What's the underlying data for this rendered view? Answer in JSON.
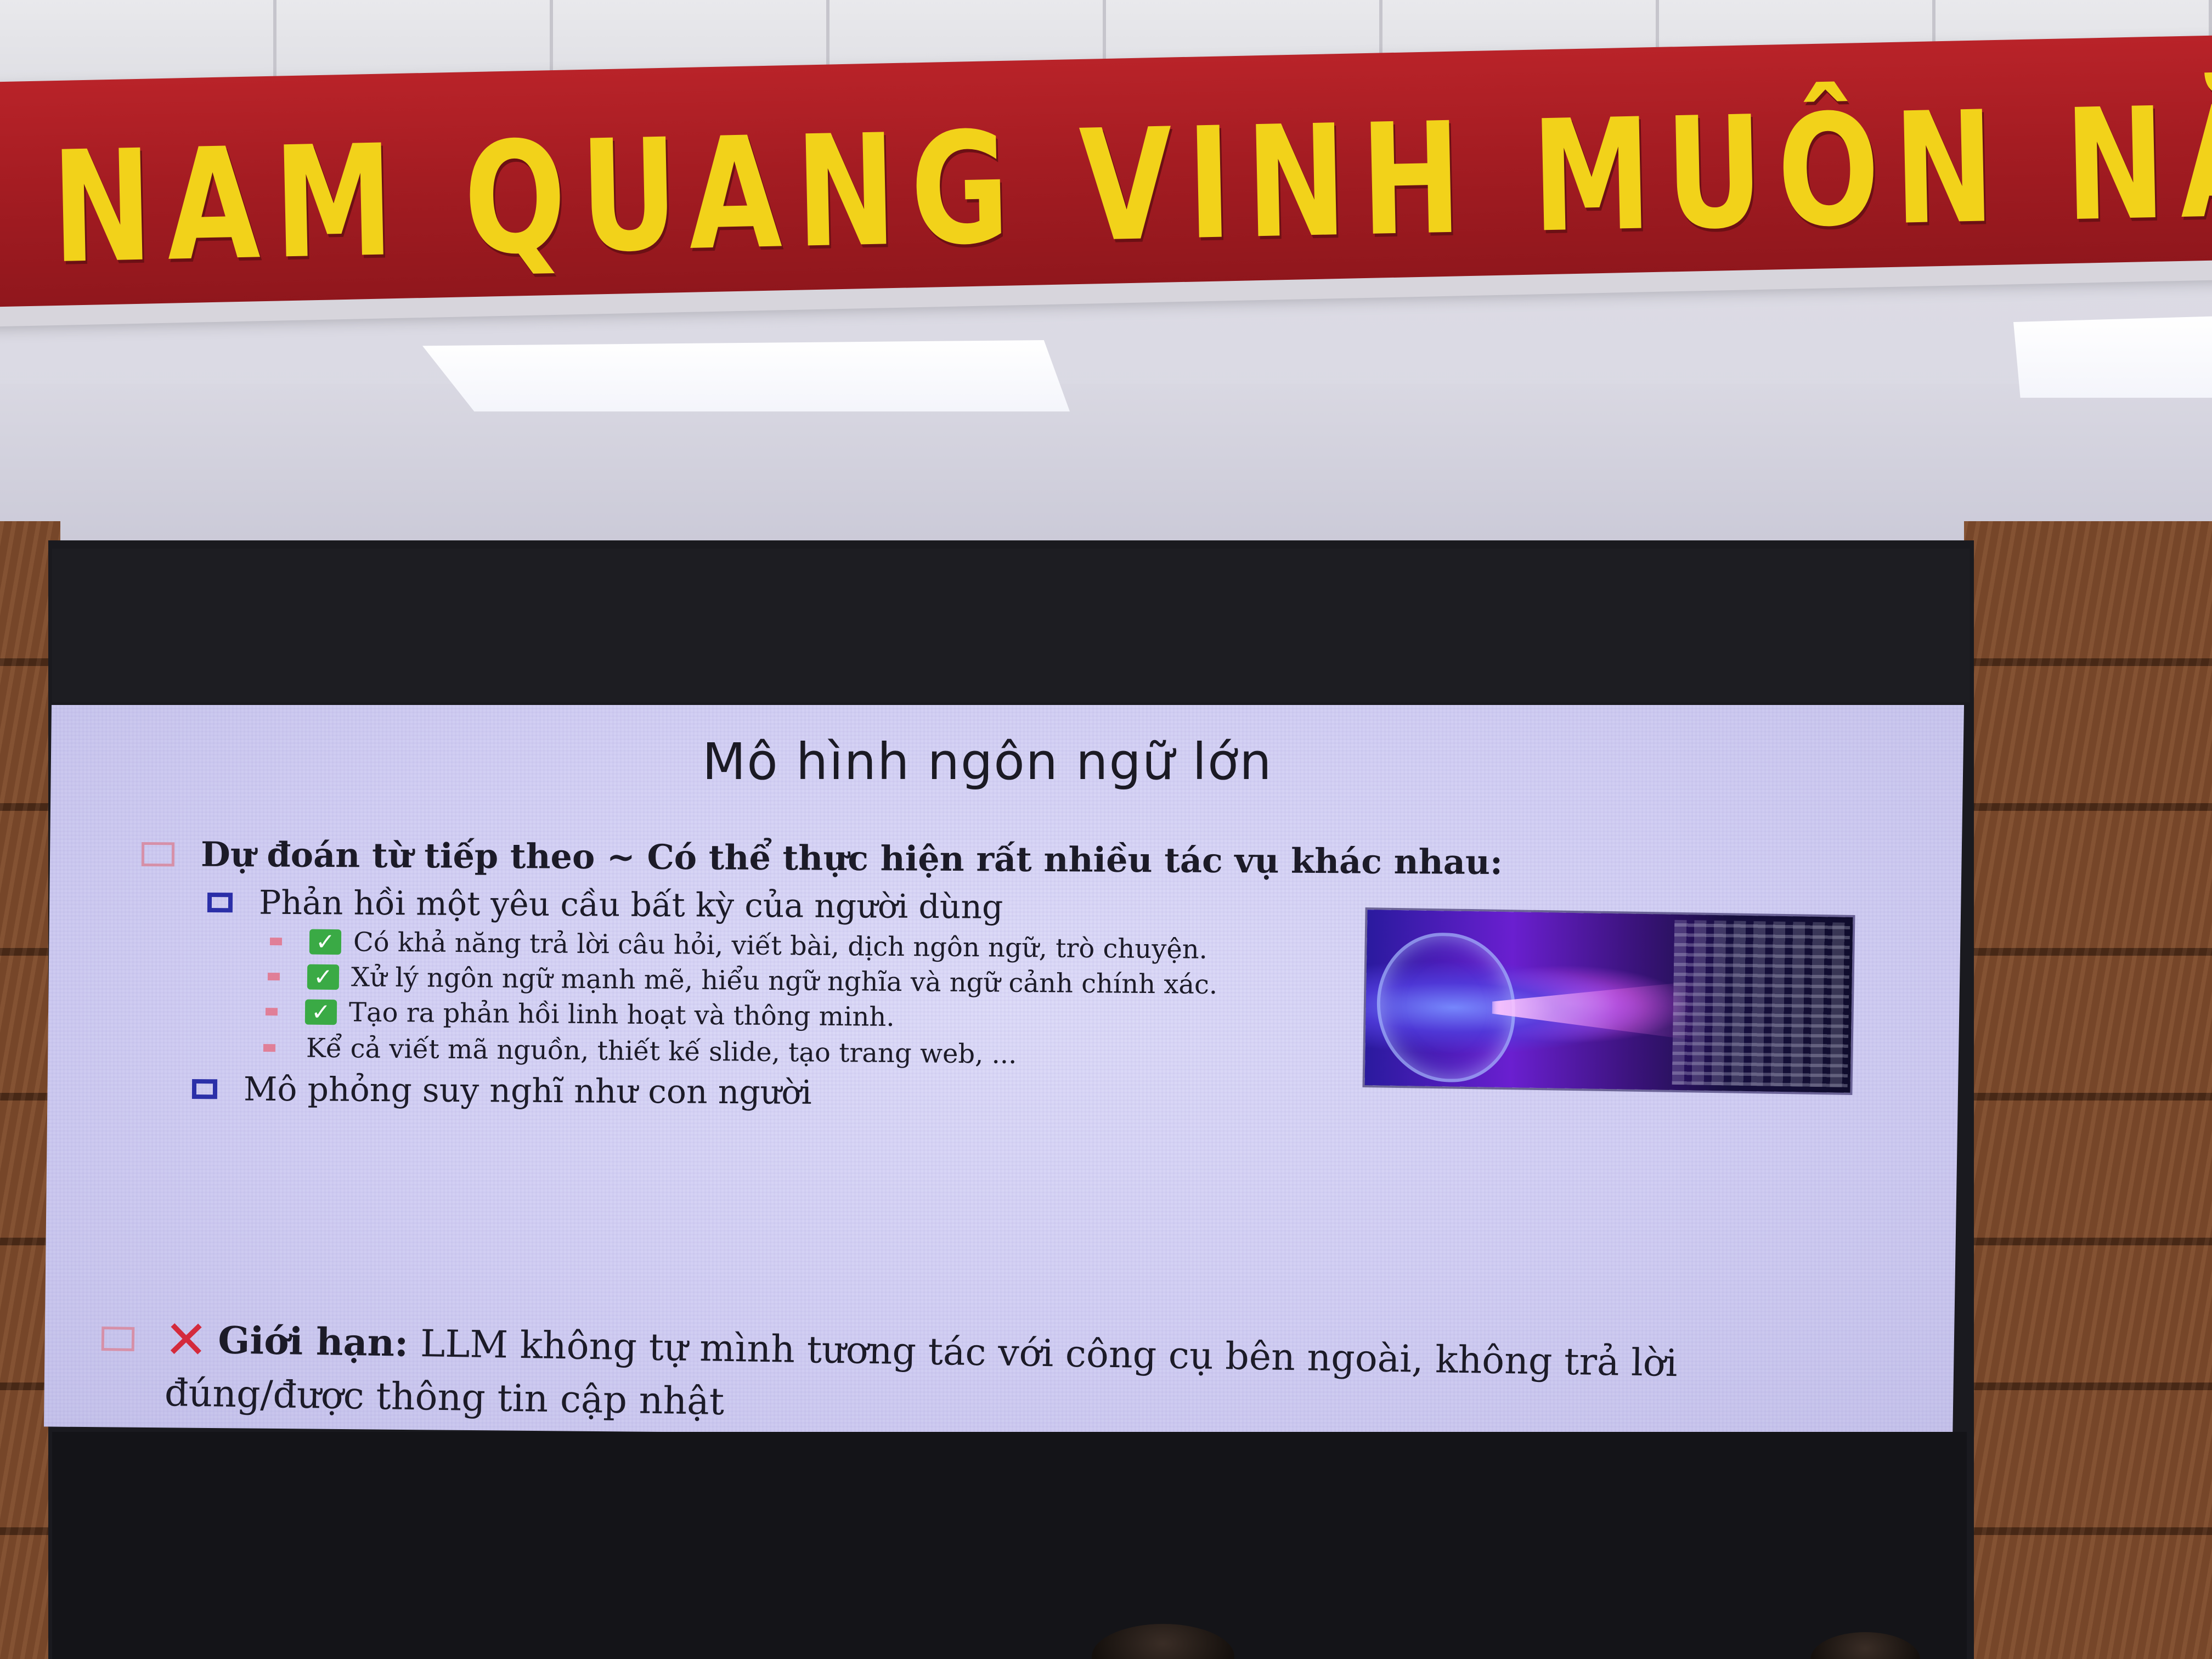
{
  "banner": {
    "text": "NAM QUANG VINH MUÔN NĂM"
  },
  "slide": {
    "title": "Mô hình ngôn ngữ lớn",
    "main_bullet": "Dự đoán từ tiếp theo ~ Có thể thực hiện rất nhiều tác vụ khác nhau:",
    "sub_bullet_1": "Phản hồi một yêu cầu bất kỳ của người dùng",
    "items": [
      "Có khả năng trả lời câu hỏi, viết bài, dịch ngôn ngữ, trò chuyện.",
      "Xử lý ngôn ngữ mạnh mẽ, hiểu ngữ nghĩa và ngữ cảnh chính xác.",
      "Tạo ra phản hồi linh hoạt và thông minh.",
      "Kể cả viết mã nguồn, thiết kế slide, tạo trang web, ..."
    ],
    "sub_bullet_2": "Mô phỏng suy nghĩ như con người",
    "limit_label": "Giới hạn:",
    "limit_line_1": "LLM không tự mình tương tác với công cụ bên ngoài, không trả lời",
    "limit_line_2": "đúng/được thông tin cập nhật"
  },
  "icons": {
    "check": "check-mark-icon",
    "cross": "cross-mark-icon"
  },
  "colors": {
    "banner_red": "#a41c22",
    "banner_yellow": "#f2d21a",
    "slide_bg": "#d2cff3",
    "check_green": "#3aaa45",
    "cross_red": "#d42a3c",
    "bullet_blue": "#2b2fa8",
    "bullet_pink": "#d690a8"
  }
}
